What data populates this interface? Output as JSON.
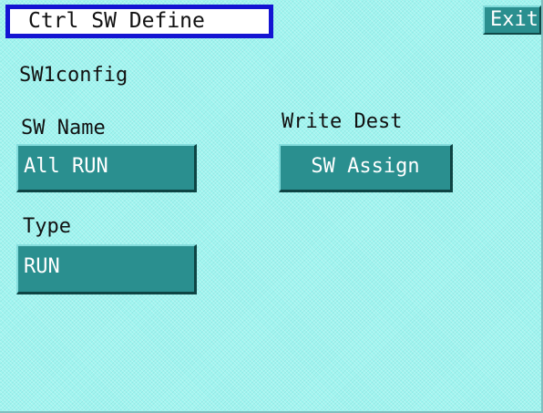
{
  "header": {
    "title": "Ctrl SW Define",
    "exit_label": "Exit"
  },
  "section": {
    "heading": "SW1config"
  },
  "sw_name": {
    "label": "SW Name",
    "value": "All RUN"
  },
  "write_dest": {
    "label": "Write Dest",
    "value": "SW Assign"
  },
  "type": {
    "label": "Type",
    "value": "RUN"
  },
  "colors": {
    "background": "#9ff5f0",
    "button": "#2a8f8f",
    "title_border": "#1414d2",
    "button_text": "#ffffff"
  }
}
